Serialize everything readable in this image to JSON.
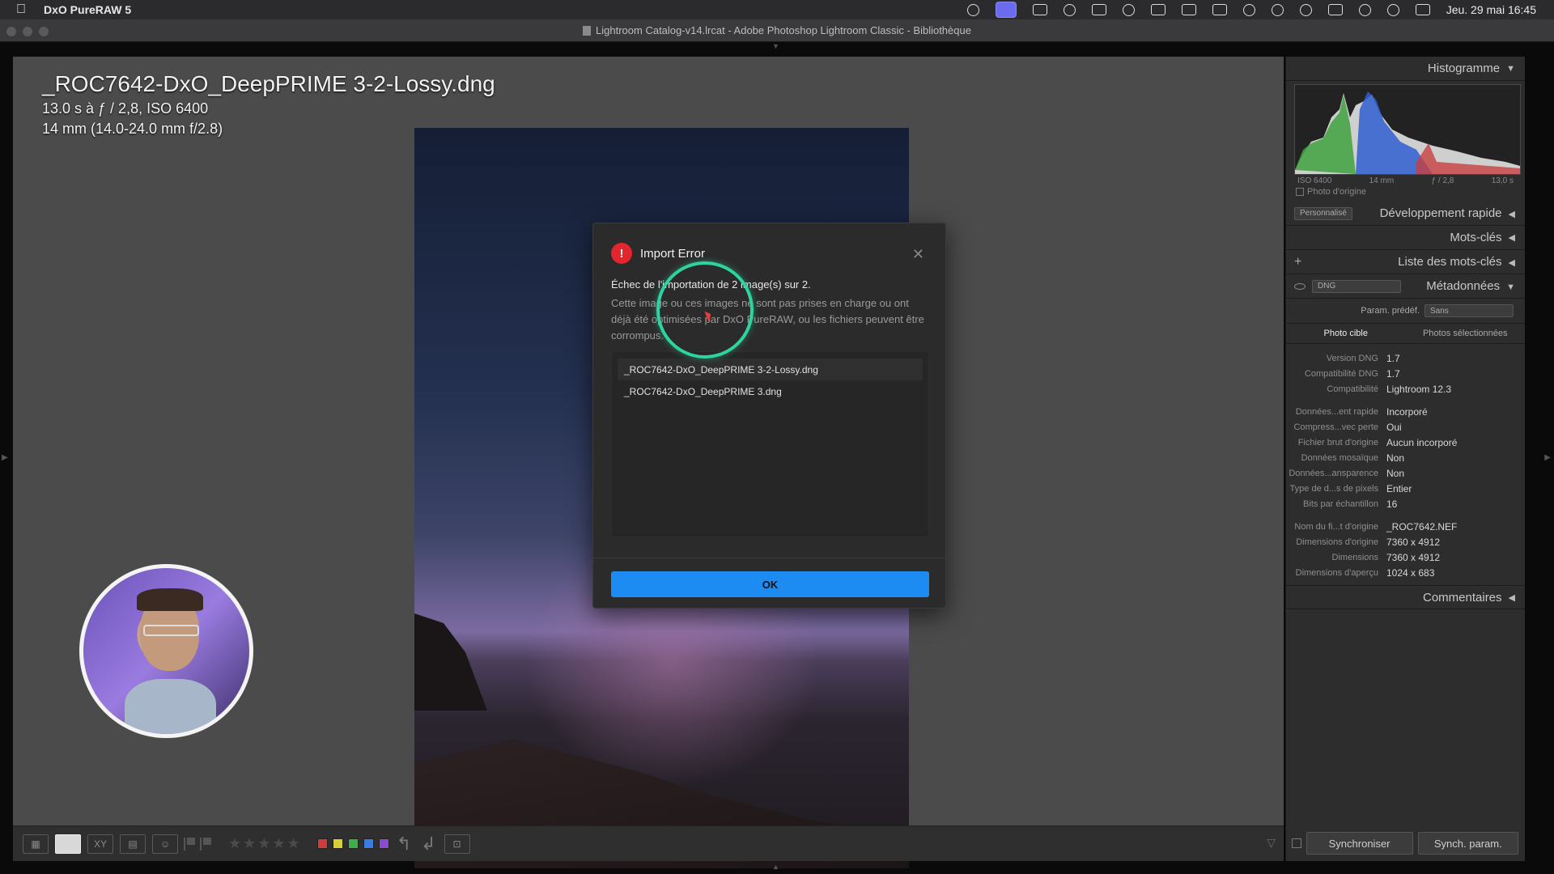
{
  "menubar": {
    "app_name": "DxO PureRAW 5",
    "clock": "Jeu. 29 mai  16:45"
  },
  "window": {
    "title": "Lightroom Catalog-v14.lrcat - Adobe Photoshop Lightroom Classic - Bibliothèque"
  },
  "photo_info": {
    "filename": "_ROC7642-DxO_DeepPRIME 3-2-Lossy.dng",
    "exposure": "13.0 s à ƒ / 2,8, ISO 6400",
    "lens": "14 mm (14.0-24.0 mm f/2.8)"
  },
  "dialog": {
    "title": "Import Error",
    "message": "Échec de l'importation de 2 image(s) sur 2.",
    "description": "Cette image ou ces images ne sont pas prises en charge ou ont déjà été optimisées par DxO PureRAW, ou les fichiers peuvent être corrompus.",
    "files": [
      "_ROC7642-DxO_DeepPRIME 3-2-Lossy.dng",
      "_ROC7642-DxO_DeepPRIME 3.dng"
    ],
    "ok_label": "OK",
    "colors": {
      "ok_button": "#1d8cf2",
      "error_icon": "#e3262d",
      "cursor_ring": "#2fd3a0"
    }
  },
  "right_panel": {
    "histogram_label": "Histogramme",
    "histo_meta": [
      "ISO 6400",
      "14 mm",
      "ƒ / 2,8",
      "13,0 s"
    ],
    "original_photo_label": "Photo d'origine",
    "quick_dev_preset": "Personnalisé",
    "quick_dev_label": "Développement rapide",
    "keywords_label": "Mots-clés",
    "keyword_list_label": "Liste des mots-clés",
    "metadata_preset": "DNG",
    "metadata_label": "Métadonnées",
    "preset_label": "Param. prédéf.",
    "preset_value": "Sans",
    "tab_target": "Photo cible",
    "tab_selected": "Photos sélectionnées",
    "comments_label": "Commentaires",
    "meta_rows": [
      {
        "k": "Version DNG",
        "v": "1.7"
      },
      {
        "k": "Compatibilité DNG",
        "v": "1.7"
      },
      {
        "k": "Compatibilité",
        "v": "Lightroom 12.3"
      },
      {
        "k": "Données...ent rapide",
        "v": "Incorporé"
      },
      {
        "k": "Compress...vec perte",
        "v": "Oui"
      },
      {
        "k": "Fichier brut d'origine",
        "v": "Aucun incorporé"
      },
      {
        "k": "Données mosaïque",
        "v": "Non"
      },
      {
        "k": "Données...ansparence",
        "v": "Non"
      },
      {
        "k": "Type de d...s de pixels",
        "v": "Entier"
      },
      {
        "k": "Bits par échantillon",
        "v": "16"
      },
      {
        "k": "Nom du fi...t d'origine",
        "v": "_ROC7642.NEF"
      },
      {
        "k": "Dimensions d'origine",
        "v": "7360 x 4912"
      },
      {
        "k": "Dimensions",
        "v": "7360 x 4912"
      },
      {
        "k": "Dimensions d'aperçu",
        "v": "1024 x 683"
      }
    ],
    "sync_label": "Synchroniser",
    "sync_settings_label": "Synch. param."
  },
  "toolbar": {
    "stars": "★★★★★",
    "label_colors": [
      "#d23b3b",
      "#d8d03a",
      "#3fae48",
      "#3a7ce0",
      "#8a4bd0"
    ]
  }
}
